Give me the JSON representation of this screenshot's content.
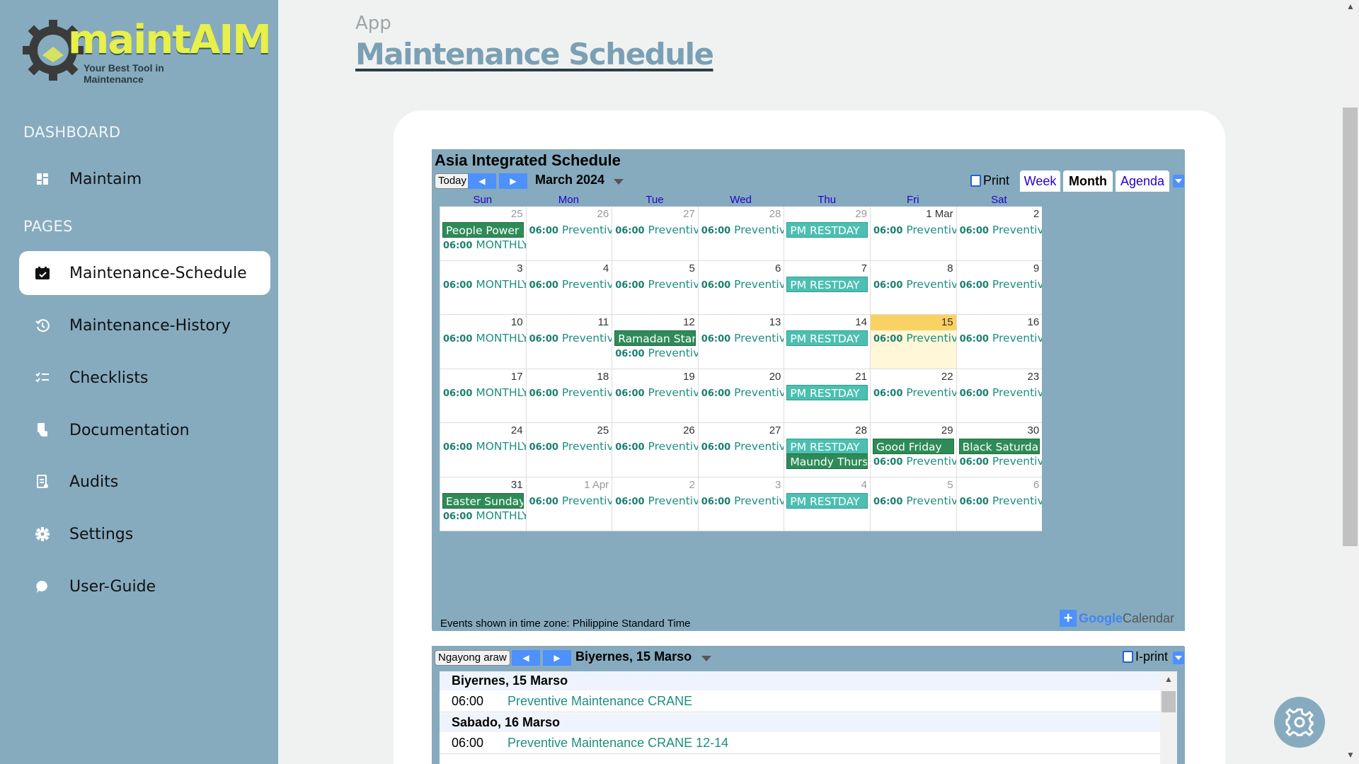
{
  "sidebar": {
    "logo": {
      "brand": "maintAIM",
      "tagline": "Your Best Tool in Maintenance"
    },
    "sections": [
      {
        "title": "DASHBOARD",
        "items": [
          {
            "label": "Maintaim",
            "icon": "dashboard-grid-icon"
          }
        ]
      },
      {
        "title": "PAGES",
        "items": [
          {
            "label": "Maintenance-Schedule",
            "icon": "calendar-check-icon",
            "active": true
          },
          {
            "label": "Maintenance-History",
            "icon": "history-icon"
          },
          {
            "label": "Checklists",
            "icon": "checklist-icon"
          },
          {
            "label": "Documentation",
            "icon": "document-hand-icon"
          },
          {
            "label": "Audits",
            "icon": "audit-clipboard-icon"
          },
          {
            "label": "Settings",
            "icon": "gear-icon"
          },
          {
            "label": "User-Guide",
            "icon": "chat-bubble-icon"
          }
        ]
      }
    ]
  },
  "header": {
    "breadcrumb": "App",
    "title": "Maintenance Schedule"
  },
  "calendar": {
    "title": "Asia Integrated Schedule",
    "today_label": "Today",
    "month_label": "March 2024",
    "print_label": "Print",
    "tabs": [
      {
        "label": "Week"
      },
      {
        "label": "Month",
        "active": true
      },
      {
        "label": "Agenda"
      }
    ],
    "weekdays": [
      "Sun",
      "Mon",
      "Tue",
      "Wed",
      "Thu",
      "Fri",
      "Sat"
    ],
    "weeks": [
      [
        {
          "day": "25",
          "other": true,
          "events": [
            {
              "kind": "allday",
              "color": "green",
              "title": "People Power Anniversary"
            },
            {
              "kind": "timed",
              "time": "06:00",
              "title": "MONTHLY PREVENTIVE"
            }
          ]
        },
        {
          "day": "26",
          "other": true,
          "events": [
            {
              "kind": "timed",
              "time": "06:00",
              "title": "Preventive Maintenance"
            }
          ]
        },
        {
          "day": "27",
          "other": true,
          "events": [
            {
              "kind": "timed",
              "time": "06:00",
              "title": "Preventive Maintenance"
            }
          ]
        },
        {
          "day": "28",
          "other": true,
          "events": [
            {
              "kind": "timed",
              "time": "06:00",
              "title": "Preventive Maintenance"
            }
          ]
        },
        {
          "day": "29",
          "other": true,
          "events": [
            {
              "kind": "allday",
              "color": "teal",
              "title": "PM RESTDAY"
            }
          ]
        },
        {
          "day": "1 Mar",
          "events": [
            {
              "kind": "timed",
              "time": "06:00",
              "title": "Preventive Maintenance"
            }
          ]
        },
        {
          "day": "2",
          "events": [
            {
              "kind": "timed",
              "time": "06:00",
              "title": "Preventive Maintenance"
            }
          ]
        }
      ],
      [
        {
          "day": "3",
          "events": [
            {
              "kind": "timed",
              "time": "06:00",
              "title": "MONTHLY PREVENTIVE"
            }
          ]
        },
        {
          "day": "4",
          "events": [
            {
              "kind": "timed",
              "time": "06:00",
              "title": "Preventive Maintenance"
            }
          ]
        },
        {
          "day": "5",
          "events": [
            {
              "kind": "timed",
              "time": "06:00",
              "title": "Preventive Maintenance"
            }
          ]
        },
        {
          "day": "6",
          "events": [
            {
              "kind": "timed",
              "time": "06:00",
              "title": "Preventive Maintenance"
            }
          ]
        },
        {
          "day": "7",
          "events": [
            {
              "kind": "allday",
              "color": "teal",
              "title": "PM RESTDAY"
            }
          ]
        },
        {
          "day": "8",
          "events": [
            {
              "kind": "timed",
              "time": "06:00",
              "title": "Preventive Maintenance"
            }
          ]
        },
        {
          "day": "9",
          "events": [
            {
              "kind": "timed",
              "time": "06:00",
              "title": "Preventive Maintenance"
            }
          ]
        }
      ],
      [
        {
          "day": "10",
          "events": [
            {
              "kind": "timed",
              "time": "06:00",
              "title": "MONTHLY PREVENTIVE"
            }
          ]
        },
        {
          "day": "11",
          "events": [
            {
              "kind": "timed",
              "time": "06:00",
              "title": "Preventive Maintenance"
            }
          ]
        },
        {
          "day": "12",
          "events": [
            {
              "kind": "allday",
              "color": "green",
              "title": "Ramadan Start"
            },
            {
              "kind": "timed",
              "time": "06:00",
              "title": "Preventive Maintenance"
            }
          ]
        },
        {
          "day": "13",
          "events": [
            {
              "kind": "timed",
              "time": "06:00",
              "title": "Preventive Maintenance"
            }
          ]
        },
        {
          "day": "14",
          "events": [
            {
              "kind": "allday",
              "color": "teal",
              "title": "PM RESTDAY"
            }
          ]
        },
        {
          "day": "15",
          "today": true,
          "events": [
            {
              "kind": "timed",
              "time": "06:00",
              "title": "Preventive Maintenance"
            }
          ]
        },
        {
          "day": "16",
          "events": [
            {
              "kind": "timed",
              "time": "06:00",
              "title": "Preventive Maintenance"
            }
          ]
        }
      ],
      [
        {
          "day": "17",
          "events": [
            {
              "kind": "timed",
              "time": "06:00",
              "title": "MONTHLY PREVENTIVE"
            }
          ]
        },
        {
          "day": "18",
          "events": [
            {
              "kind": "timed",
              "time": "06:00",
              "title": "Preventive Maintenance"
            }
          ]
        },
        {
          "day": "19",
          "events": [
            {
              "kind": "timed",
              "time": "06:00",
              "title": "Preventive Maintenance"
            }
          ]
        },
        {
          "day": "20",
          "events": [
            {
              "kind": "timed",
              "time": "06:00",
              "title": "Preventive Maintenance"
            }
          ]
        },
        {
          "day": "21",
          "events": [
            {
              "kind": "allday",
              "color": "teal",
              "title": "PM RESTDAY"
            }
          ]
        },
        {
          "day": "22",
          "events": [
            {
              "kind": "timed",
              "time": "06:00",
              "title": "Preventive Maintenance"
            }
          ]
        },
        {
          "day": "23",
          "events": [
            {
              "kind": "timed",
              "time": "06:00",
              "title": "Preventive Maintenance"
            }
          ]
        }
      ],
      [
        {
          "day": "24",
          "events": [
            {
              "kind": "timed",
              "time": "06:00",
              "title": "MONTHLY PREVENTIVE"
            }
          ]
        },
        {
          "day": "25",
          "events": [
            {
              "kind": "timed",
              "time": "06:00",
              "title": "Preventive Maintenance"
            }
          ]
        },
        {
          "day": "26",
          "events": [
            {
              "kind": "timed",
              "time": "06:00",
              "title": "Preventive Maintenance"
            }
          ]
        },
        {
          "day": "27",
          "events": [
            {
              "kind": "timed",
              "time": "06:00",
              "title": "Preventive Maintenance"
            }
          ]
        },
        {
          "day": "28",
          "events": [
            {
              "kind": "allday",
              "color": "teal",
              "title": "PM RESTDAY"
            },
            {
              "kind": "allday",
              "color": "green",
              "title": "Maundy Thursday"
            }
          ]
        },
        {
          "day": "29",
          "events": [
            {
              "kind": "allday",
              "color": "green",
              "title": "Good Friday"
            },
            {
              "kind": "timed",
              "time": "06:00",
              "title": "Preventive Maintenance"
            }
          ]
        },
        {
          "day": "30",
          "events": [
            {
              "kind": "allday",
              "color": "green",
              "title": "Black Saturday"
            },
            {
              "kind": "timed",
              "time": "06:00",
              "title": "Preventive Maintenance"
            }
          ]
        }
      ],
      [
        {
          "day": "31",
          "events": [
            {
              "kind": "allday",
              "color": "green",
              "title": "Easter Sunday"
            },
            {
              "kind": "timed",
              "time": "06:00",
              "title": "MONTHLY PREVENTIVE"
            }
          ]
        },
        {
          "day": "1 Apr",
          "other": true,
          "events": [
            {
              "kind": "timed",
              "time": "06:00",
              "title": "Preventive Maintenance"
            }
          ]
        },
        {
          "day": "2",
          "other": true,
          "events": [
            {
              "kind": "timed",
              "time": "06:00",
              "title": "Preventive Maintenance"
            }
          ]
        },
        {
          "day": "3",
          "other": true,
          "events": [
            {
              "kind": "timed",
              "time": "06:00",
              "title": "Preventive Maintenance"
            }
          ]
        },
        {
          "day": "4",
          "other": true,
          "events": [
            {
              "kind": "allday",
              "color": "teal",
              "title": "PM RESTDAY"
            }
          ]
        },
        {
          "day": "5",
          "other": true,
          "events": [
            {
              "kind": "timed",
              "time": "06:00",
              "title": "Preventive Maintenance"
            }
          ]
        },
        {
          "day": "6",
          "other": true,
          "events": [
            {
              "kind": "timed",
              "time": "06:00",
              "title": "Preventive Maintenance"
            }
          ]
        }
      ]
    ],
    "timezone_text": "Events shown in time zone: Philippine Standard Time",
    "gcal_google": "Google",
    "gcal_calendar": "Calendar"
  },
  "agenda": {
    "today_label": "Ngayong araw",
    "date_label": "Biyernes, 15 Marso",
    "print_label": "I-print",
    "days": [
      {
        "heading": "Biyernes, 15 Marso",
        "events": [
          {
            "time": "06:00",
            "title": "Preventive Maintenance CRANE"
          }
        ]
      },
      {
        "heading": "Sabado, 16 Marso",
        "events": [
          {
            "time": "06:00",
            "title": "Preventive Maintenance CRANE 12-14"
          }
        ]
      }
    ]
  },
  "colors": {
    "sidebar": "#86abbf",
    "event_green": "#2e8b57",
    "event_teal": "#4cbfb1",
    "event_text": "#1d8f7f",
    "today": "#fff7d7"
  }
}
